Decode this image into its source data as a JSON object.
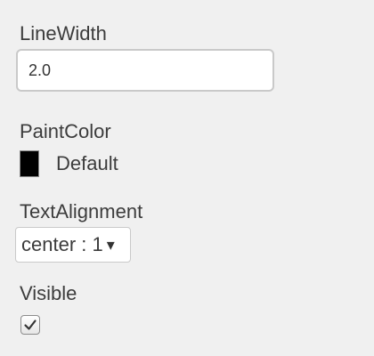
{
  "properties": {
    "line_width": {
      "label": "LineWidth",
      "value": "2.0"
    },
    "paint_color": {
      "label": "PaintColor",
      "swatch_color": "#000000",
      "color_name": "Default"
    },
    "text_alignment": {
      "label": "TextAlignment",
      "selected": "center : 1",
      "arrow_icon": "triangle-down-icon"
    },
    "visible": {
      "label": "Visible",
      "checked": true,
      "check_icon": "checkmark-icon"
    }
  }
}
